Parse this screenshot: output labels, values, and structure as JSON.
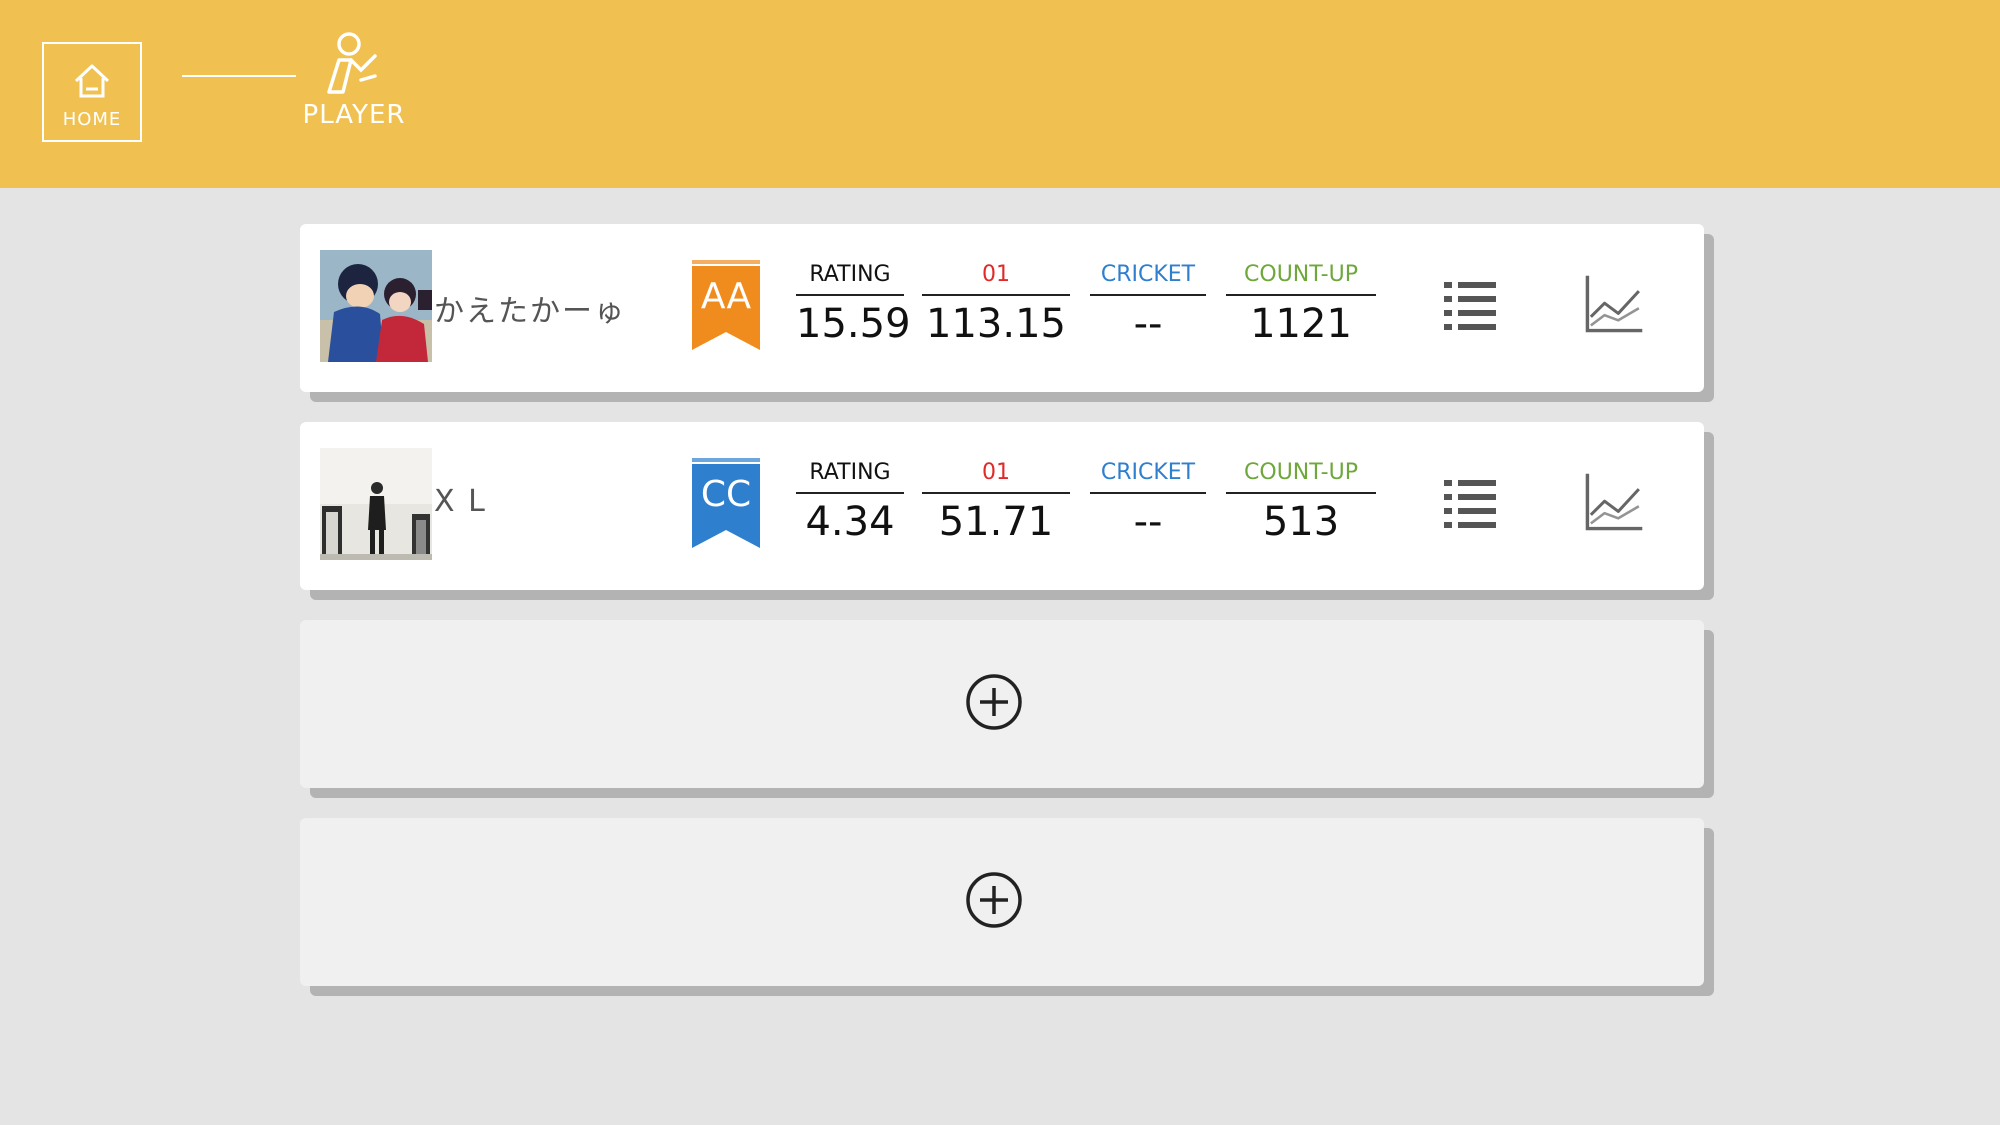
{
  "header": {
    "home_label": "HOME",
    "player_label": "PLAYER",
    "background": "#f0c150"
  },
  "players": [
    {
      "name": "かえたかーゅ",
      "rank": "AA",
      "rank_color": "#f08c1e",
      "rating_label": "RATING",
      "rating": "15.59",
      "zero_one_label": "01",
      "zero_one": "113.15",
      "cricket_label": "CRICKET",
      "cricket": "--",
      "countup_label": "COUNT-UP",
      "countup": "1121"
    },
    {
      "name": "X L",
      "rank": "CC",
      "rank_color": "#2f7fcf",
      "rating_label": "RATING",
      "rating": "4.34",
      "zero_one_label": "01",
      "zero_one": "51.71",
      "cricket_label": "CRICKET",
      "cricket": "--",
      "countup_label": "COUNT-UP",
      "countup": "513"
    }
  ],
  "empty_slots": [
    {
      "icon": "add-circle-icon"
    },
    {
      "icon": "add-circle-icon"
    }
  ],
  "colors": {
    "label_01": "#e02a2a",
    "label_cricket": "#2f7fcf",
    "label_countup": "#6ea83a"
  }
}
